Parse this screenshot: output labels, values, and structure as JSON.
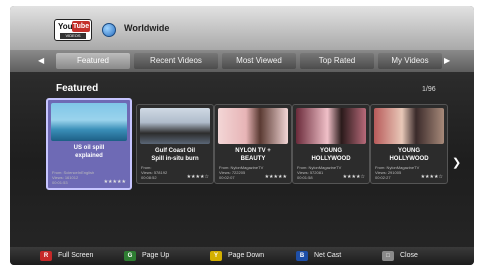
{
  "header": {
    "logo": {
      "you": "You",
      "tube": "Tube",
      "sub": "VIDEOS"
    },
    "region_icon": "globe-icon",
    "region": "Worldwide"
  },
  "tabs": [
    {
      "label": "Featured",
      "active": true
    },
    {
      "label": "Recent Videos",
      "active": false
    },
    {
      "label": "Most Viewed",
      "active": false
    },
    {
      "label": "Top Rated",
      "active": false
    },
    {
      "label": "My Videos",
      "active": false
    }
  ],
  "section": {
    "title": "Featured",
    "page": "1/96"
  },
  "cards": [
    {
      "title1": "US oil spill",
      "title2": "explained",
      "from": "From: ScienceInEnglish",
      "views": "Views: 161012",
      "time": "00:01:53",
      "stars": "★★★★★",
      "thumb": "linear-gradient(#7fc6e8 0%, #9ad3ec 45%, #3a8fb8 70%, #1d5f86 100%)"
    },
    {
      "title1": "Gulf Coast Oil",
      "title2": "Spill in-situ burn",
      "from": "From:",
      "views": "Views: 578192",
      "time": "00:08:52",
      "stars": "★★★★☆",
      "thumb": "linear-gradient(#cfd9e4 0%, #b0bccb 40%, #2d2d2d 70%, #5a6676 100%)"
    },
    {
      "title1": "NYLON TV +",
      "title2": "BEAUTY",
      "from": "From: NylonMagazineTV",
      "views": "Views: 722205",
      "time": "00:02:07",
      "stars": "★★★★★",
      "thumb": "linear-gradient(90deg, #f3d6d6 0%, #e7b4b6 40%, #5a3a32 60%, #f3d6d6 100%)"
    },
    {
      "title1": "YOUNG",
      "title2": "HOLLYWOOD",
      "from": "From: NylonMagazineTV",
      "views": "Views: 572081",
      "time": "00:01:58",
      "stars": "★★★★☆",
      "thumb": "linear-gradient(90deg, #6a2a3a 0%, #f0c0c8 45%, #2a1a1a 65%, #b86a7a 100%)"
    },
    {
      "title1": "YOUNG",
      "title2": "HOLLYWOOD",
      "from": "From: NylonMagazineTV",
      "views": "Views: 291005",
      "time": "00:02:27",
      "stars": "★★★★☆",
      "thumb": "linear-gradient(90deg, #b85a5a 0%, #e8c8b8 40%, #3a2a2a 60%, #a88a7a 100%)"
    }
  ],
  "footer": [
    {
      "key": "R",
      "label": "Full Screen",
      "color": "#c62828"
    },
    {
      "key": "G",
      "label": "Page Up",
      "color": "#2e7d32"
    },
    {
      "key": "Y",
      "label": "Page Down",
      "color": "#d4b000"
    },
    {
      "key": "B",
      "label": "Net Cast",
      "color": "#1e4fa8"
    },
    {
      "key": "□",
      "label": "Close",
      "color": "#8a8a8a"
    }
  ]
}
